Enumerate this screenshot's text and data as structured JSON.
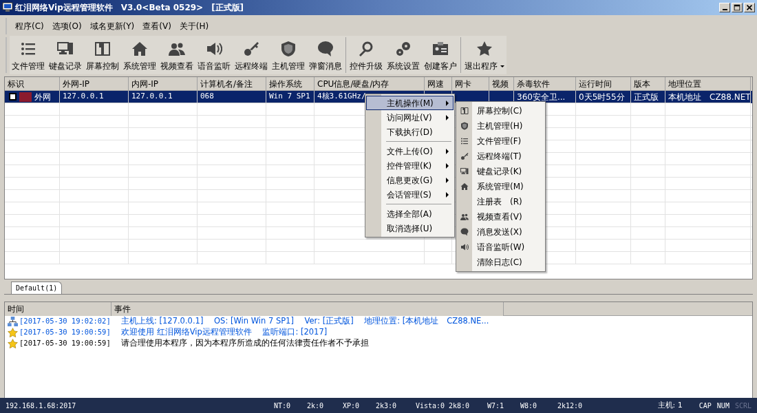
{
  "window": {
    "title": "红泪网络Vip远程管理软件　V3.0<Beta 0529>　[正式版]"
  },
  "menu_bar": [
    "程序(C)",
    "选项(O)",
    "域名更新(Y)",
    "查看(V)",
    "关于(H)"
  ],
  "toolbar": [
    {
      "label": "文件管理",
      "kind": "list"
    },
    {
      "label": "键盘记录",
      "kind": "computer"
    },
    {
      "label": "屏幕控制",
      "kind": "book"
    },
    {
      "label": "系统管理",
      "kind": "house"
    },
    {
      "label": "视频查看",
      "kind": "people"
    },
    {
      "label": "语音监听",
      "kind": "speaker"
    },
    {
      "label": "远程终端",
      "kind": "key"
    },
    {
      "label": "主机管理",
      "kind": "shield"
    },
    {
      "label": "弹窗消息",
      "kind": "bubble"
    },
    {
      "label": "控件升级",
      "kind": "magnifier",
      "group_start": true
    },
    {
      "label": "系统设置",
      "kind": "gears"
    },
    {
      "label": "创建客户",
      "kind": "card"
    },
    {
      "label": "退出程序",
      "kind": "star",
      "group_start": true,
      "dropdown": true
    }
  ],
  "table": {
    "columns": [
      "标识",
      "外网-IP",
      "内网-IP",
      "计算机名/备注",
      "操作系统",
      "CPU信息/硬盘/内存",
      "网速",
      "网卡",
      "视频",
      "杀毒软件",
      "运行时间",
      "版本",
      "地理位置"
    ],
    "rows": [
      {
        "selected": true,
        "checked": false,
        "cells": [
          "外网",
          "127.0.0.1",
          "127.0.0.1",
          "068",
          "Win 7 SP1",
          "4核3.61GHz/",
          "",
          "",
          "",
          "360安全卫...",
          "0天5时55分",
          "正式版",
          "本机地址　CZ88.NET"
        ]
      }
    ]
  },
  "context_menu": {
    "items": [
      {
        "kind": "item",
        "label": "主机操作(M)",
        "submenu": true,
        "selected": true
      },
      {
        "kind": "item",
        "label": "访问网址(V)",
        "submenu": true,
        "selected": false
      },
      {
        "kind": "item",
        "label": "下载执行(D)",
        "submenu": false,
        "selected": false
      },
      {
        "kind": "separator"
      },
      {
        "kind": "item",
        "label": "文件上传(O)",
        "submenu": true,
        "selected": false
      },
      {
        "kind": "item",
        "label": "控件管理(K)",
        "submenu": true,
        "selected": false
      },
      {
        "kind": "item",
        "label": "信息更改(G)",
        "submenu": true,
        "selected": false
      },
      {
        "kind": "item",
        "label": "会话管理(S)",
        "submenu": true,
        "selected": false
      },
      {
        "kind": "separator"
      },
      {
        "kind": "item",
        "label": "选择全部(A)",
        "submenu": false,
        "selected": false
      },
      {
        "kind": "item",
        "label": "取消选择(U)",
        "submenu": false,
        "selected": false
      }
    ]
  },
  "submenu": {
    "items": [
      {
        "label": "屏幕控制(C)",
        "kind": "book"
      },
      {
        "label": "主机管理(H)",
        "kind": "shield"
      },
      {
        "label": "文件管理(F)",
        "kind": "list"
      },
      {
        "label": "远程终端(T)",
        "kind": "key"
      },
      {
        "label": "键盘记录(K)",
        "kind": "computer"
      },
      {
        "label": "系统管理(M)",
        "kind": "house"
      },
      {
        "label": "注册表　(R)",
        "kind": "none"
      },
      {
        "label": "视频查看(V)",
        "kind": "people"
      },
      {
        "label": "消息发送(X)",
        "kind": "bubble"
      },
      {
        "label": "语音监听(W)",
        "kind": "speaker"
      },
      {
        "label": "清除日志(C)",
        "kind": "none"
      }
    ]
  },
  "group_tabs": [
    {
      "label": "Default(1)",
      "selected": true
    }
  ],
  "log": {
    "columns": [
      "时间",
      "事件"
    ],
    "rows": [
      {
        "kind": "online",
        "color": "#0055dd",
        "time": "[2017-05-30 19:02:02]",
        "event": "主机上线: [127.0.0.1]　 OS: [Win Win 7 SP1]　 Ver: [正式版]　 地理位置: [本机地址　CZ88.NE..."
      },
      {
        "kind": "star",
        "color": "#0055dd",
        "time": "[2017-05-30 19:00:59]",
        "event": "欢迎使用 红泪网络Vip远程管理软件　 监听端口: [2017]"
      },
      {
        "kind": "star",
        "color": "#000000",
        "time": "[2017-05-30 19:00:59]",
        "event": "请合理使用本程序，因为本程序所造成的任何法律责任作者不予承担"
      }
    ]
  },
  "status_bar": {
    "address": "192.168.1.68:2017",
    "counts": [
      "NT:0",
      "2k:0",
      "XP:0",
      "2k3:0",
      "Vista:0",
      "2k8:0",
      "W7:1",
      "W8:0",
      "2k12:0"
    ],
    "hosts": "主机: 1",
    "indicators": [
      {
        "label": "CAP",
        "on": true
      },
      {
        "label": "NUM",
        "on": true
      },
      {
        "label": "SCRL",
        "on": false
      }
    ]
  }
}
